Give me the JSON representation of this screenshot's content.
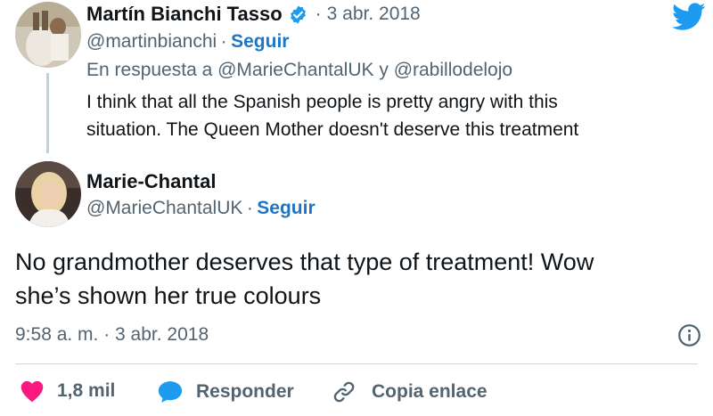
{
  "parent_tweet": {
    "author_name": "Martín Bianchi Tasso",
    "dot": "·",
    "date": "3 abr. 2018",
    "handle": "@martinbianchi",
    "follow": "Seguir",
    "reply_prefix": "En respuesta a",
    "reply_user1": "@MarieChantalUK",
    "reply_and": "y",
    "reply_user2": "@rabillodelojo",
    "text_line1": "I think that all the Spanish people is pretty angry with this",
    "text_line2": "situation. The Queen Mother doesn't deserve this treatment"
  },
  "main_tweet": {
    "author_name": "Marie-Chantal",
    "handle": "@MarieChantalUK",
    "dot": "·",
    "follow": "Seguir",
    "text_line1": "No grandmother deserves that type of treatment! Wow",
    "text_line2": "she’s shown her true colours",
    "timestamp": "9:58 a. m. · 3 abr. 2018"
  },
  "actions": {
    "likes": "1,8 mil",
    "reply": "Responder",
    "copy_link": "Copia enlace"
  },
  "colors": {
    "brand_blue": "#1d9bf0",
    "link_blue": "#1d75c5",
    "like_red": "#f91880",
    "verified": "#1d9bf0"
  },
  "icons": [
    "twitter-bird-icon",
    "verified-badge-icon",
    "info-icon",
    "heart-icon",
    "reply-bubble-icon",
    "link-icon"
  ]
}
